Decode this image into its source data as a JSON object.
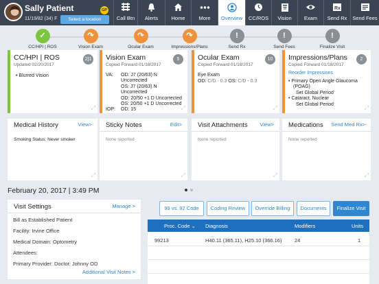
{
  "header": {
    "patient_name": "Sally Patient",
    "patient_info": "11/19/82 (34) F",
    "badge": "GP",
    "select_location": "Select a location",
    "nav": [
      {
        "label": "Call Btn",
        "icon": "call-button-icon"
      },
      {
        "label": "Alerts",
        "icon": "bell-icon"
      },
      {
        "label": "Home",
        "icon": "home-icon"
      },
      {
        "label": "More",
        "icon": "more-dots-icon"
      },
      {
        "label": "Overview",
        "icon": "user-icon",
        "active": true
      },
      {
        "label": "CC/ROS",
        "icon": "clock-icon"
      },
      {
        "label": "Vision",
        "icon": "vision-chart-icon"
      },
      {
        "label": "Exam",
        "icon": "eye-icon"
      },
      {
        "label": "Send Rx",
        "icon": "send-rx-icon"
      },
      {
        "label": "Send Fees",
        "icon": "send-fees-icon"
      }
    ]
  },
  "progress": {
    "steps": [
      {
        "label": "CC/HPI | ROS",
        "state": "done",
        "symbol": "✓"
      },
      {
        "label": "Vision Exam",
        "state": "forward",
        "symbol": "↷"
      },
      {
        "label": "Ocular Exam",
        "state": "forward",
        "symbol": "↷"
      },
      {
        "label": "Impressions/Plans",
        "state": "forward",
        "symbol": "↷"
      },
      {
        "label": "Send Rx",
        "state": "alert",
        "symbol": "!"
      },
      {
        "label": "Send Fees",
        "state": "alert",
        "symbol": "!"
      },
      {
        "label": "Finalize Visit",
        "state": "alert",
        "symbol": "!"
      }
    ]
  },
  "cards": {
    "cchpi": {
      "title": "CC/HPI | ROS",
      "subtitle": "Updated 02/20/2017",
      "badge": "2|1",
      "items": [
        "Blurred Vision"
      ]
    },
    "vision": {
      "title": "Vision Exam",
      "subtitle": "Copied Forward 01/18/2017",
      "badge": "5",
      "rows": [
        {
          "k": "VA:",
          "v": "OD: J7 (20/63) N"
        },
        {
          "k": "",
          "v": "Uncorrected"
        },
        {
          "k": "",
          "v": "OS: J7 (20/63) N"
        },
        {
          "k": "",
          "v": "Uncorrected"
        },
        {
          "k": "",
          "v": "OD: 20/50 +1 D Uncorrected"
        },
        {
          "k": "",
          "v": "OS: 20/50 +1 D Uncorrected"
        },
        {
          "k": "IOP:",
          "v": "OD: 15"
        },
        {
          "k": "",
          "v": "OS: 15"
        }
      ]
    },
    "ocular": {
      "title": "Ocular Exam",
      "subtitle": "Copied Forward 01/18/2017",
      "badge": "10",
      "heading": "Eye Exam",
      "od_label": "OD:",
      "od_value": "C/D - 0.3",
      "os_label": "OS:",
      "os_value": "C/D - 0.3"
    },
    "impressions": {
      "title": "Impressions/Plans",
      "subtitle": "Copied Forward 01/18/2017",
      "badge": "2",
      "reorder": "Reorder Impressions",
      "items": [
        {
          "l1": "Primary Open Angle Glaucoma",
          "l2": "(POAG)",
          "l3": "Set Global Period"
        },
        {
          "l1": "Cataract, Nuclear",
          "l2": "Set Global Period"
        }
      ]
    }
  },
  "mid_cards": {
    "medical_history": {
      "title": "Medical History",
      "link": "View>",
      "body": "Smoking Status: Never smoker"
    },
    "sticky_notes": {
      "title": "Sticky Notes",
      "link": "Edit>",
      "body": "None reported"
    },
    "visit_attachments": {
      "title": "Visit Attachments",
      "link": "View>",
      "body": "None reported"
    },
    "medications": {
      "title": "Medications",
      "link": "Send Med Rx>",
      "body": "None reported"
    }
  },
  "visit": {
    "date_title": "February 20, 2017 | 3:49 PM",
    "settings": {
      "title": "Visit Settings",
      "manage": "Manage >",
      "billing": "Bill as Established Patient",
      "facility_label": "Facility:",
      "facility": "Irvine Office",
      "domain_label": "Medical Domain:",
      "domain": "Optometry",
      "attendees_label": "Attendees:",
      "provider_label": "Primary Provider:",
      "provider": "Doctor, Johnny OD",
      "additional_notes": "Additional Visit Notes >"
    },
    "buttons": [
      "99 vs. 92 Code",
      "Coding Review",
      "Override Billing",
      "Documents",
      "Finalize Visit"
    ],
    "table": {
      "headers": [
        "Proc. Code",
        "Diagnosis",
        "Modifiers",
        "Units"
      ],
      "sort_indicator": "⌄",
      "rows": [
        {
          "code": "99213",
          "diagnosis": "H40.11 (365.11), H25.10 (366.16)",
          "modifiers": "24",
          "units": "1"
        }
      ]
    }
  },
  "colors": {
    "header": "#3a4452",
    "blue": "#2f86d1",
    "green": "#7cc63f",
    "orange": "#f0923b",
    "gray": "#8b9097"
  }
}
